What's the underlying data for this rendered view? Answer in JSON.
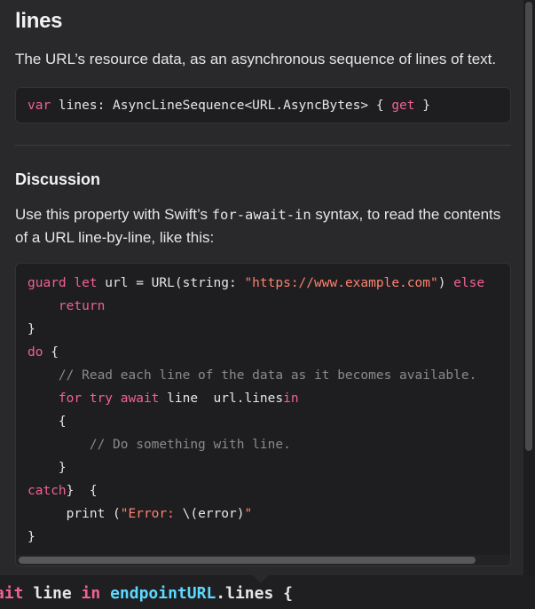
{
  "popover": {
    "title": "lines",
    "abstract": "The URL’s resource data, as an asynchronous sequence of lines of text.",
    "declaration": {
      "kw_var": "var",
      "rest": " lines: AsyncLineSequence<URL.AsyncBytes> { ",
      "kw_get": "get",
      "close": " }"
    },
    "discussion_heading": "Discussion",
    "discussion": {
      "before": "Use this property with Swift’s ",
      "inline_code": "for-await-in",
      "after": " syntax, to read the contents of a URL line-by-line, like this:"
    },
    "code_lines": [
      {
        "k1": "guard let",
        "t1": " url = URL(string: ",
        "s1": "\"https://www.example.com\"",
        "t2": ") ",
        "k2": "else"
      },
      {
        "indent": "    ",
        "k1": "return"
      },
      {
        "t1": "}"
      },
      {
        "k1": "do",
        "t1": " {"
      },
      {
        "indent": "    ",
        "c1": "// Read each line of the data as it becomes available."
      },
      {
        "indent": "    ",
        "k1": "for try await",
        "t1": " line ",
        "k2": "in",
        "t2": " url.lines"
      },
      {
        "indent": "    ",
        "t1": "{"
      },
      {
        "indent": "        ",
        "c1": "// Do something with line."
      },
      {
        "indent": "    ",
        "t1": "}"
      },
      {
        "t1": "} ",
        "k1": "catch",
        "t2": " {"
      },
      {
        "indent": "     ",
        "t1": "print (",
        "s1": "\"Error: ",
        "t2": "\\(error)",
        "s2": "\""
      },
      {
        "t1": "}"
      }
    ]
  },
  "editor": {
    "prefix_kw": "ait",
    "mid": " line ",
    "kw_in": "in",
    "ident": "endpointURL",
    "rest": ".lines {"
  },
  "colors": {
    "keyword": "#f06292",
    "string": "#ff8170",
    "comment": "#8a8a8e",
    "identifier": "#5dd8ff"
  }
}
